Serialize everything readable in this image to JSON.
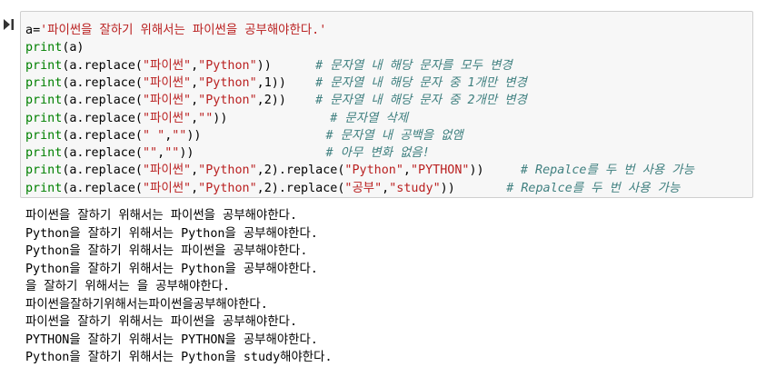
{
  "code": [
    [
      {
        "t": "a",
        "c": ""
      },
      {
        "t": "=",
        "c": ""
      },
      {
        "t": "'파이썬을 잘하기 위해서는 파이썬을 공부해야한다.'",
        "c": "str"
      }
    ],
    [
      {
        "t": "print",
        "c": "kw"
      },
      {
        "t": "(a)",
        "c": ""
      }
    ],
    [
      {
        "t": "print",
        "c": "kw"
      },
      {
        "t": "(a.replace(",
        "c": ""
      },
      {
        "t": "\"파이썬\"",
        "c": "str"
      },
      {
        "t": ",",
        "c": ""
      },
      {
        "t": "\"Python\"",
        "c": "str"
      },
      {
        "t": "))",
        "c": ""
      },
      {
        "t": "      # 문자열 내 해당 문자를 모두 변경",
        "c": "cm"
      }
    ],
    [
      {
        "t": "print",
        "c": "kw"
      },
      {
        "t": "(a.replace(",
        "c": ""
      },
      {
        "t": "\"파이썬\"",
        "c": "str"
      },
      {
        "t": ",",
        "c": ""
      },
      {
        "t": "\"Python\"",
        "c": "str"
      },
      {
        "t": ",1))",
        "c": ""
      },
      {
        "t": "    # 문자열 내 해당 문자 중 1개만 변경",
        "c": "cm"
      }
    ],
    [
      {
        "t": "print",
        "c": "kw"
      },
      {
        "t": "(a.replace(",
        "c": ""
      },
      {
        "t": "\"파이썬\"",
        "c": "str"
      },
      {
        "t": ",",
        "c": ""
      },
      {
        "t": "\"Python\"",
        "c": "str"
      },
      {
        "t": ",2))",
        "c": ""
      },
      {
        "t": "    # 문자열 내 해당 문자 중 2개만 변경",
        "c": "cm"
      }
    ],
    [
      {
        "t": "print",
        "c": "kw"
      },
      {
        "t": "(a.replace(",
        "c": ""
      },
      {
        "t": "\"파이썬\"",
        "c": "str"
      },
      {
        "t": ",",
        "c": ""
      },
      {
        "t": "\"\"",
        "c": "str"
      },
      {
        "t": "))",
        "c": ""
      },
      {
        "t": "              # 문자열 삭제",
        "c": "cm"
      }
    ],
    [
      {
        "t": "print",
        "c": "kw"
      },
      {
        "t": "(a.replace(",
        "c": ""
      },
      {
        "t": "\" \"",
        "c": "str"
      },
      {
        "t": ",",
        "c": ""
      },
      {
        "t": "\"\"",
        "c": "str"
      },
      {
        "t": "))",
        "c": ""
      },
      {
        "t": "                 # 문자열 내 공백을 없앰",
        "c": "cm"
      }
    ],
    [
      {
        "t": "print",
        "c": "kw"
      },
      {
        "t": "(a.replace(",
        "c": ""
      },
      {
        "t": "\"\"",
        "c": "str"
      },
      {
        "t": ",",
        "c": ""
      },
      {
        "t": "\"\"",
        "c": "str"
      },
      {
        "t": "))",
        "c": ""
      },
      {
        "t": "                  # 아무 변화 없음!",
        "c": "cm"
      }
    ],
    [
      {
        "t": "print",
        "c": "kw"
      },
      {
        "t": "(a.replace(",
        "c": ""
      },
      {
        "t": "\"파이썬\"",
        "c": "str"
      },
      {
        "t": ",",
        "c": ""
      },
      {
        "t": "\"Python\"",
        "c": "str"
      },
      {
        "t": ",2).replace(",
        "c": ""
      },
      {
        "t": "\"Python\"",
        "c": "str"
      },
      {
        "t": ",",
        "c": ""
      },
      {
        "t": "\"PYTHON\"",
        "c": "str"
      },
      {
        "t": "))",
        "c": ""
      },
      {
        "t": "     # Repalce를 두 번 사용 가능",
        "c": "cm"
      }
    ],
    [
      {
        "t": "print",
        "c": "kw"
      },
      {
        "t": "(a.replace(",
        "c": ""
      },
      {
        "t": "\"파이썬\"",
        "c": "str"
      },
      {
        "t": ",",
        "c": ""
      },
      {
        "t": "\"Python\"",
        "c": "str"
      },
      {
        "t": ",2).replace(",
        "c": ""
      },
      {
        "t": "\"공부\"",
        "c": "str"
      },
      {
        "t": ",",
        "c": ""
      },
      {
        "t": "\"study\"",
        "c": "str"
      },
      {
        "t": "))",
        "c": ""
      },
      {
        "t": "       # Repalce를 두 번 사용 가능",
        "c": "cm"
      }
    ]
  ],
  "output": [
    "파이썬을 잘하기 위해서는 파이썬을 공부해야한다.",
    "Python을 잘하기 위해서는 Python을 공부해야한다.",
    "Python을 잘하기 위해서는 파이썬을 공부해야한다.",
    "Python을 잘하기 위해서는 Python을 공부해야한다.",
    "을 잘하기 위해서는 을 공부해야한다.",
    "파이썬을잘하기위해서는파이썬을공부해야한다.",
    "파이썬을 잘하기 위해서는 파이썬을 공부해야한다.",
    "PYTHON을 잘하기 위해서는 PYTHON을 공부해야한다.",
    "Python을 잘하기 위해서는 Python을 study해야한다."
  ],
  "run_icon": "run-cell-icon",
  "colors": {
    "keyword": "#008000",
    "string": "#ba2121",
    "comment": "#408080",
    "cell_bg": "#f7f7f7",
    "cell_border": "#cfcfcf"
  }
}
